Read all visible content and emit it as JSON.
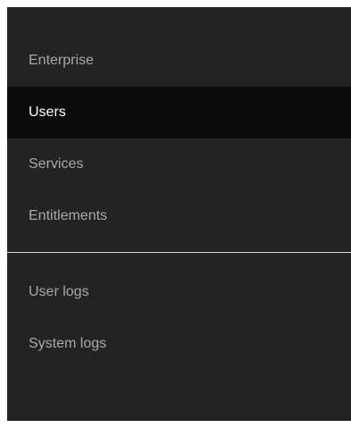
{
  "nav": {
    "primary": [
      {
        "label": "Enterprise",
        "active": false
      },
      {
        "label": "Users",
        "active": true
      },
      {
        "label": "Services",
        "active": false
      },
      {
        "label": "Entitlements",
        "active": false
      }
    ],
    "secondary": [
      {
        "label": "User logs",
        "active": false
      },
      {
        "label": "System logs",
        "active": false
      }
    ]
  },
  "colors": {
    "sidebar_bg": "#232323",
    "active_bg": "#0b0b0b",
    "active_text": "#ffffff",
    "inactive_text": "#a9a9a9",
    "divider": "#d9d9d9"
  }
}
